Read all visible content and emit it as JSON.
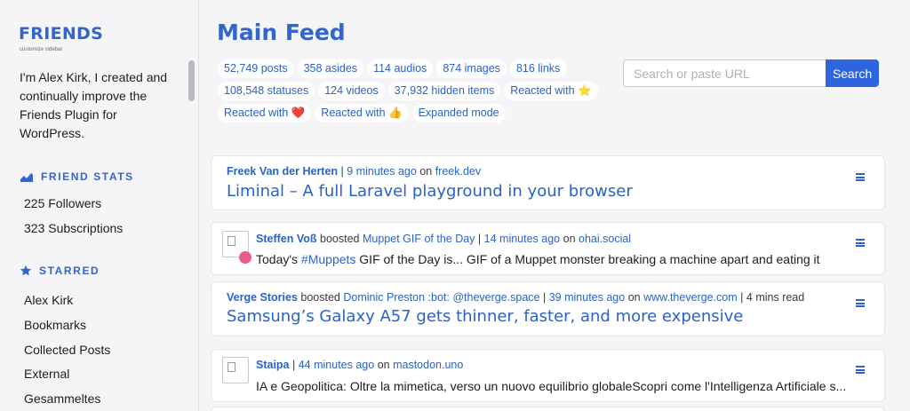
{
  "sidebar": {
    "brand": "FRIENDS",
    "customize": "customize sidebar",
    "intro": "I'm Alex Kirk, I created and continually improve the Friends Plugin for WordPress.",
    "stats_heading": "FRIEND STATS",
    "stats": [
      "225 Followers",
      "323 Subscriptions"
    ],
    "starred_heading": "STARRED",
    "starred": [
      "Alex Kirk",
      "Bookmarks",
      "Collected Posts",
      "External",
      "Gesammeltes"
    ]
  },
  "main": {
    "title": "Main Feed",
    "chips": [
      "52,749 posts",
      "358 asides",
      "114 audios",
      "874 images",
      "816 links",
      "108,548 statuses",
      "124 videos",
      "37,932 hidden items",
      "Reacted with ⭐",
      "Reacted with ❤️",
      "Reacted with 👍",
      "Expanded mode"
    ],
    "search_placeholder": "Search or paste URL",
    "search_button": "Search"
  },
  "posts": [
    {
      "author": "Freek Van der Herten",
      "time": "9 minutes ago",
      "on": "on",
      "site": "freek.dev",
      "title": "Liminal – A full Laravel playground in your browser"
    },
    {
      "author": "Steffen Voß",
      "boosted": "boosted",
      "boost_source": "Muppet GIF of the Day",
      "time": "14 minutes ago",
      "on": "on",
      "site": "ohai.social",
      "snippet_pre": "Today's ",
      "snippet_tag": "#Muppets",
      "snippet_post": " GIF of the Day is... GIF of a Muppet monster breaking a machine apart and eating it"
    },
    {
      "author": "Verge Stories",
      "boosted": "boosted",
      "boost_source": "Dominic Preston :bot: @theverge.space",
      "time": "39 minutes ago",
      "on": "on",
      "site": "www.theverge.com",
      "read_time": "4 mins read",
      "title": "Samsung’s Galaxy A57 gets thinner, faster, and more expensive"
    },
    {
      "author": "Staipa",
      "time": "44 minutes ago",
      "on": "on",
      "site": "mastodon.uno",
      "snippet": "IA e Geopolitica: Oltre la mimetica, verso un nuovo equilibrio globaleScopri come l'Intelligenza Artificiale s..."
    }
  ],
  "icons": {
    "stats": "chart-icon",
    "starred": "star-icon",
    "menu": "hamburger-menu-icon"
  },
  "colors": {
    "accent": "#3366cc",
    "button": "#2f64e0",
    "background": "#f5f5f7"
  }
}
